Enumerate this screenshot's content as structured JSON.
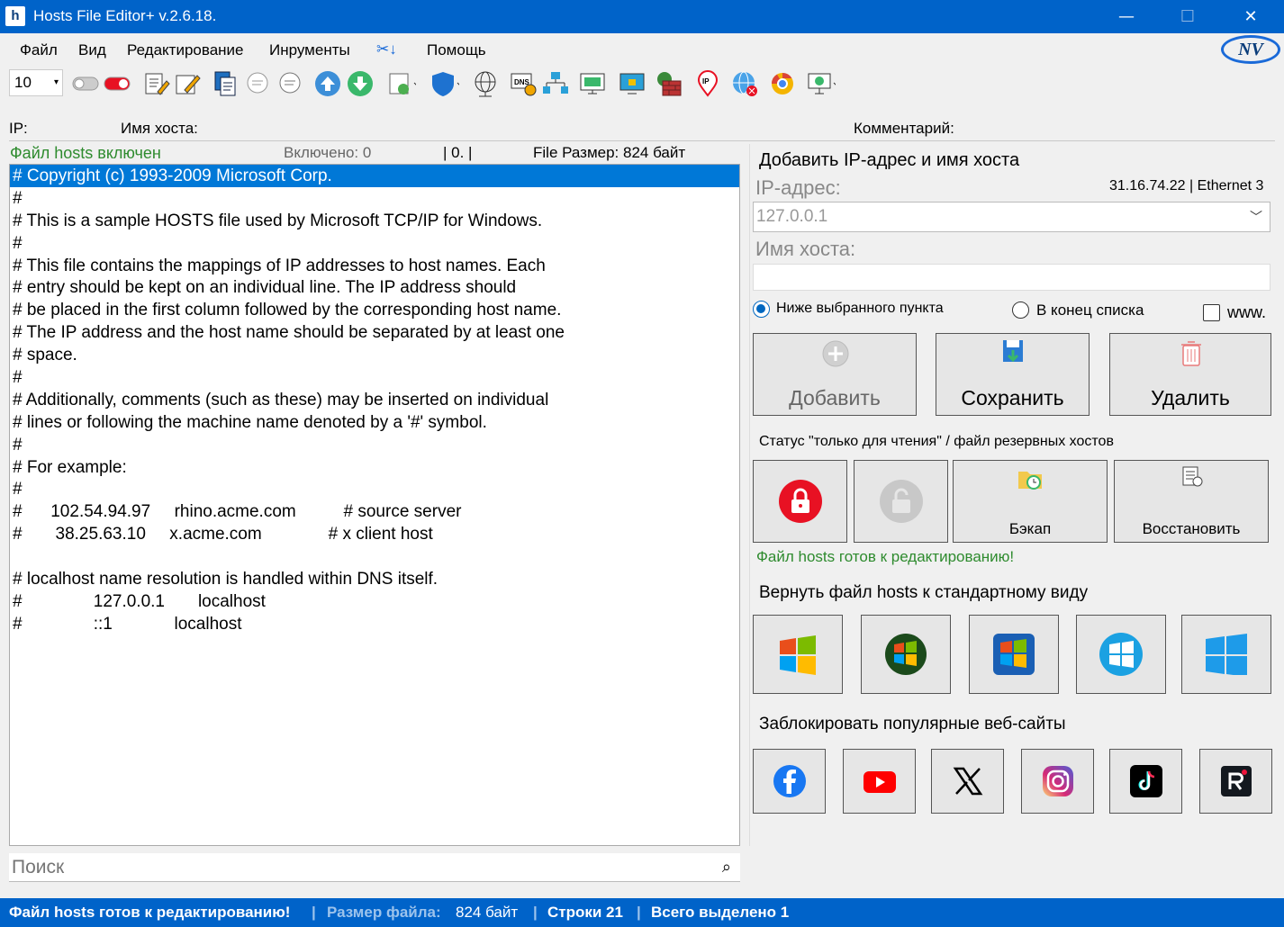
{
  "window": {
    "title": "Hosts File Editor+ v.2.6.18.",
    "app_icon": "h",
    "minimize": "—",
    "maximize": "☐",
    "close": "✕"
  },
  "menu": [
    "Файл",
    "Вид",
    "Редактирование",
    "Инрументы",
    "Помощь"
  ],
  "logo": "NV",
  "toolbar": {
    "font_size": "10",
    "icons": [
      "toggle-off-icon",
      "toggle-on-icon",
      "edit-icon",
      "edit-pencil-icon",
      "copy-icon",
      "comment-icon",
      "uncomment-icon",
      "move-up-icon",
      "move-down-icon",
      "add-file-icon",
      "defender-icon",
      "globe-network-icon",
      "dns-icon",
      "network-icon",
      "monitor-icon",
      "monitor-lock-icon",
      "firewall-icon",
      "ip-pin-icon",
      "globe-block-icon",
      "chrome-icon",
      "settings-monitor-icon"
    ]
  },
  "fields": {
    "ip_label": "IP:",
    "host_label": "Имя хоста:",
    "comment_label": "Комментарий:"
  },
  "file_status": {
    "enabled_text": "Файл hosts включен",
    "included": "Включено: 0",
    "counter": "| 0. |",
    "file_size": "File Размер: 824 байт"
  },
  "editor_lines": [
    "# Copyright (c) 1993-2009 Microsoft Corp.",
    "#",
    "# This is a sample HOSTS file used by Microsoft TCP/IP for Windows.",
    "#",
    "# This file contains the mappings of IP addresses to host names. Each",
    "# entry should be kept on an individual line. The IP address should",
    "# be placed in the first column followed by the corresponding host name.",
    "# The IP address and the host name should be separated by at least one",
    "# space.",
    "#",
    "# Additionally, comments (such as these) may be inserted on individual",
    "# lines or following the machine name denoted by a '#' symbol.",
    "#",
    "# For example:",
    "#",
    "#      102.54.94.97     rhino.acme.com          # source server",
    "#       38.25.63.10     x.acme.com              # x client host",
    "",
    "# localhost name resolution is handled within DNS itself.",
    "#               127.0.0.1       localhost",
    "#               ::1             localhost"
  ],
  "search": {
    "placeholder": "Поиск"
  },
  "add_panel": {
    "title": "Добавить IP-адрес и имя хоста",
    "ip_label": "IP-адрес:",
    "network_info": "31.16.74.22 | Ethernet 3",
    "ip_value": "127.0.0.1",
    "host_label": "Имя хоста:",
    "radio_below": "Ниже выбранного пункта",
    "radio_end": "В конец списка",
    "www_label": "www.",
    "add_button": "Добавить",
    "save_button": "Сохранить",
    "delete_button": "Удалить"
  },
  "readonly_panel": {
    "title": "Статус \"только для чтения\" / файл резервных хостов",
    "backup_button": "Бэкап",
    "restore_button": "Восстановить",
    "status_message": "Файл hosts готов к редактированию!"
  },
  "restore_panel": {
    "title": "Вернуть файл hosts к стандартному виду",
    "os_icons": [
      "windows-xp-icon",
      "windows-vista-icon",
      "windows-7-icon",
      "windows-8-icon",
      "windows-10-11-icon"
    ]
  },
  "block_panel": {
    "title": "Заблокировать популярные веб-сайты",
    "site_icons": [
      "facebook-icon",
      "youtube-icon",
      "x-twitter-icon",
      "instagram-icon",
      "tiktok-icon",
      "rutube-icon"
    ]
  },
  "statusbar": {
    "ready": "Файл hosts готов к редактированию!",
    "sep": "|",
    "size_label": "Размер файла:",
    "size_value": "824 байт",
    "lines": "Строки 21",
    "selected": "Всего выделено 1"
  },
  "colors": {
    "accent_blue": "#0063c9",
    "selection_blue": "#0078d7",
    "status_green": "#2e8b2e",
    "lock_red": "#e81123"
  }
}
